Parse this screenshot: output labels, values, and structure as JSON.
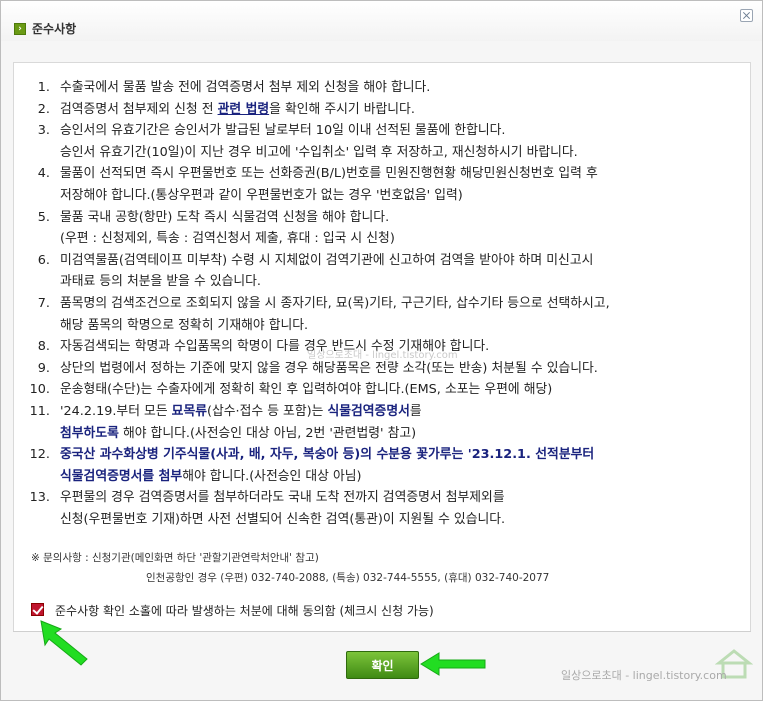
{
  "header": {
    "title": "준수사항"
  },
  "items": [
    {
      "num": "1.",
      "lines": [
        [
          {
            "t": "수출국에서 물품 발송 전에 검역증명서 첨부 제외 신청을 해야 합니다."
          }
        ]
      ]
    },
    {
      "num": "2.",
      "lines": [
        [
          {
            "t": "검역증명서 첨부제외 신청 전 "
          },
          {
            "t": "관련 법령",
            "s": "bu"
          },
          {
            "t": "을 확인해 주시기 바랍니다."
          }
        ]
      ]
    },
    {
      "num": "3.",
      "lines": [
        [
          {
            "t": "승인서의 유효기간은 승인서가 발급된 날로부터 10일 이내 선적된 물품에 한합니다."
          }
        ],
        [
          {
            "t": "승인서 유효기간(10일)이 지난 경우 비고에 '수입취소' 입력 후 저장하고, 재신청하시기 바랍니다."
          }
        ]
      ]
    },
    {
      "num": "4.",
      "lines": [
        [
          {
            "t": "물품이 선적되면 즉시 우편물번호 또는 선화증권(B/L)번호를 민원진행현황 해당민원신청번호 입력 후"
          }
        ],
        [
          {
            "t": "저장해야 합니다.(통상우편과 같이 우편물번호가 없는 경우 '번호없음' 입력)"
          }
        ]
      ]
    },
    {
      "num": "5.",
      "lines": [
        [
          {
            "t": "물품 국내 공항(항만) 도착 즉시 식물검역 신청을 해야 합니다."
          }
        ],
        [
          {
            "t": "(우편 : 신청제외, 특송 : 검역신청서 제출, 휴대 : 입국 시 신청)"
          }
        ]
      ]
    },
    {
      "num": "6.",
      "lines": [
        [
          {
            "t": "미검역물품(검역테이프 미부착) 수령 시 지체없이 검역기관에 신고하여 검역을 받아야 하며 미신고시"
          }
        ],
        [
          {
            "t": "과태료 등의 처분을 받을 수 있습니다."
          }
        ]
      ]
    },
    {
      "num": "7.",
      "lines": [
        [
          {
            "t": "품목명의 검색조건으로 조회되지 않을 시 종자기타, 묘(목)기타, 구근기타, 삽수기타 등으로 선택하시고,"
          }
        ],
        [
          {
            "t": "해당 품목의 학명으로 정확히 기재해야 합니다."
          }
        ]
      ]
    },
    {
      "num": "8.",
      "lines": [
        [
          {
            "t": "자동검색되는 학명과 수입품목의 학명이 다를 경우 반드시 수정 기재해야 합니다."
          }
        ]
      ]
    },
    {
      "num": "9.",
      "lines": [
        [
          {
            "t": "상단의 법령에서 정하는 기준에 맞지 않을 경우 해당품목은 전량 소각(또는 반송) 처분될 수 있습니다."
          }
        ]
      ]
    },
    {
      "num": "10.",
      "lines": [
        [
          {
            "t": "운송형태(수단)는 수출자에게 정확히 확인 후 입력하여야 합니다.(EMS, 소포는 우편에 해당)"
          }
        ]
      ]
    },
    {
      "num": "11.",
      "lines": [
        [
          {
            "t": "'24.2.19.부터 모든 "
          },
          {
            "t": "묘목류",
            "s": "b"
          },
          {
            "t": "(삽수·접수 등 포함)는 "
          },
          {
            "t": "식물검역증명서",
            "s": "b"
          },
          {
            "t": "를"
          }
        ],
        [
          {
            "t": "첨부하도록",
            "s": "b"
          },
          {
            "t": " 해야 합니다.(사전승인 대상 아님, 2번 '관련법령' 참고)"
          }
        ]
      ]
    },
    {
      "num": "12.",
      "lines": [
        [
          {
            "t": "중국산 과수화상병 기주식물(사과, 배, 자두, 복숭아 등)의 수분용 꽃가루는 '23.12.1. 선적분부터",
            "s": "b"
          }
        ],
        [
          {
            "t": "식물검역증명서를 첨부",
            "s": "b"
          },
          {
            "t": "해야 합니다.(사전승인 대상 아님)"
          }
        ]
      ]
    },
    {
      "num": "13.",
      "lines": [
        [
          {
            "t": "우편물의 경우 검역증명서를 첨부하더라도 국내 도착 전까지 검역증명서 첨부제외를"
          }
        ],
        [
          {
            "t": "신청(우편물번호 기재)하면 사전 선별되어 신속한 검역(통관)이 지원될 수 있습니다."
          }
        ]
      ]
    }
  ],
  "contact": {
    "line1": "※ 문의사항 : 신청기관(메인화면 하단 '관할기관연락처안내' 참고)",
    "line2": "인천공항인 경우 (우편) 032-740-2088, (특송) 032-744-5555, (휴대) 032-740-2077"
  },
  "agree": {
    "label": "준수사항 확인 소홀에 따라 발생하는 처분에 대해 동의함 (체크시 신청 가능)",
    "checked": true
  },
  "confirm_button": "확인",
  "watermark": "일상으로초대 - lingel.tistory.com",
  "watermark_center": "일상으로초대 - lingel.tistory.com",
  "colors": {
    "accent": "#1a237e",
    "button_green": "#4fa01f",
    "arrow_green": "#22dd22",
    "checkbox": "#c0152f"
  }
}
